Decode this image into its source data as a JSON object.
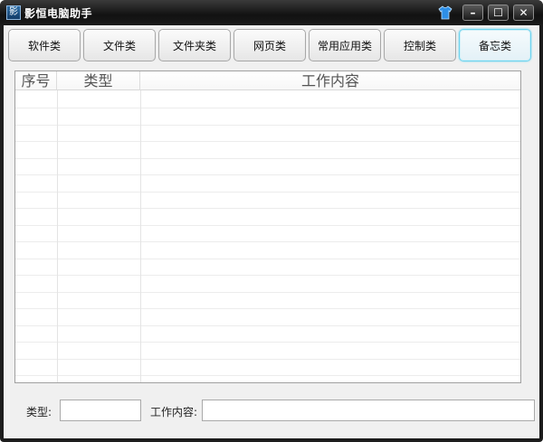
{
  "window": {
    "title": "影恒电脑助手",
    "app_icon_glyph": "影",
    "controls": {
      "minimize": "–",
      "maximize": "☐",
      "close": "✕"
    }
  },
  "tabs": [
    {
      "label": "软件类",
      "active": false
    },
    {
      "label": "文件类",
      "active": false
    },
    {
      "label": "文件夹类",
      "active": false
    },
    {
      "label": "网页类",
      "active": false
    },
    {
      "label": "常用应用类",
      "active": false
    },
    {
      "label": "控制类",
      "active": false
    },
    {
      "label": "备忘类",
      "active": true
    }
  ],
  "table": {
    "columns": [
      "序号",
      "类型",
      "工作内容"
    ],
    "rows": []
  },
  "form": {
    "type_label": "类型:",
    "type_value": "",
    "content_label": "工作内容:",
    "content_value": ""
  },
  "colors": {
    "titlebar": "#111111",
    "active_tab_border": "#6ed3ee",
    "skin_icon": "#2e8fe6"
  },
  "icons": {
    "skin": "shirt-icon",
    "app": "app-logo-icon"
  }
}
